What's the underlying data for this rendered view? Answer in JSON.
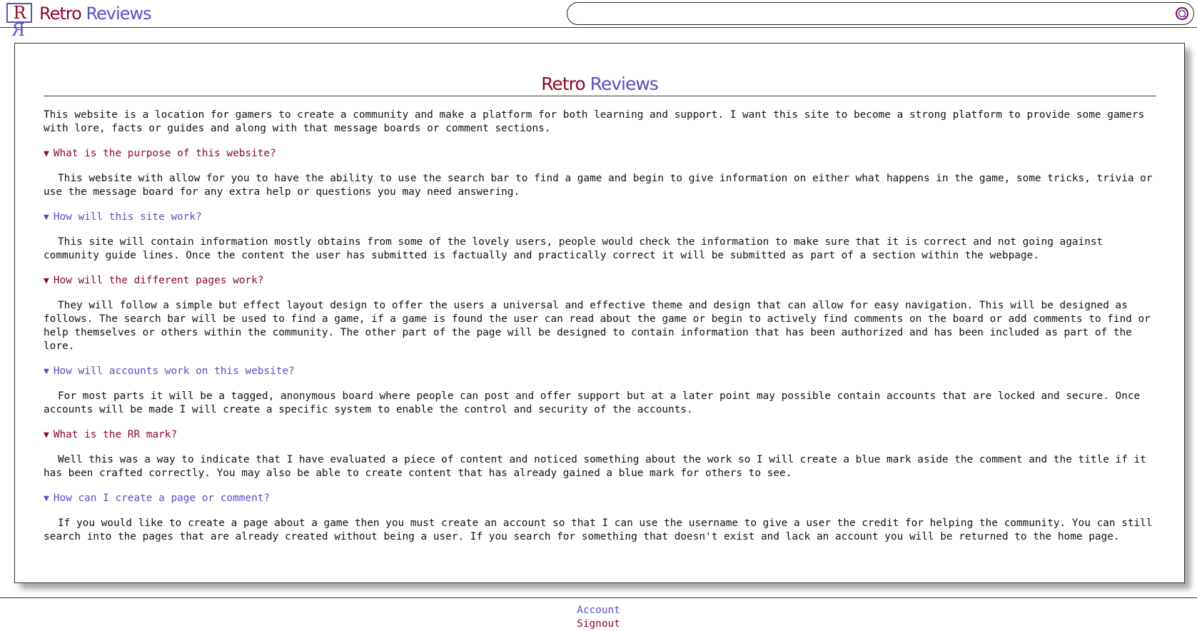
{
  "header": {
    "logo_left": "R",
    "logo_right": "R",
    "brand_word1": "Retro",
    "brand_word2": "Reviews",
    "search": {
      "value": "",
      "placeholder": ""
    }
  },
  "main": {
    "title_word1": "Retro",
    "title_word2": "Reviews",
    "intro": "This website is a location for gamers to create a community and make a platform for both learning and support. I want this site to become a strong platform to provide some gamers with lore, facts or guides and along with that message boards or comment sections.",
    "faqs": [
      {
        "question": "What is the purpose of this website?",
        "answer": "This website with allow for you to have the ability to use the search bar to find a game and begin to give information on either what happens in the game, some tricks, trivia or use the message board for any extra help or questions you may need answering."
      },
      {
        "question": "How will this site work?",
        "answer": "This site will contain information mostly obtains from some of the lovely users, people would check the information to make sure that it is correct and not going against community guide lines. Once the content the user has submitted is factually and practically correct it will be submitted as part of a section within the webpage."
      },
      {
        "question": "How will the different pages work?",
        "answer": "They will follow a simple but effect layout design to offer the users a universal and effective theme and design that can allow for easy navigation. This will be designed as follows. The search bar will be used to find a game, if a game is found the user can read about the game or begin to actively find comments on the board or add comments to find or help themselves or others within the community. The other part of the page will be designed to contain information that has been authorized and has been included as part of the lore."
      },
      {
        "question": "How will accounts work on this website?",
        "answer": "For most parts it will be a tagged, anonymous board where people can post and offer support but at a later point may possible contain accounts that are locked and secure. Once accounts will be made I will create a specific system to enable the control and security of the accounts."
      },
      {
        "question": "What is the RR mark?",
        "answer": "Well this was a way to indicate that I have evaluated a piece of content and noticed something about the work so I will create a blue mark aside the comment and the title if it has been crafted correctly. You may also be able to create content that has already gained a blue mark for others to see."
      },
      {
        "question": "How can I create a page or comment?",
        "answer": "If you would like to create a page about a game then you must create an account so that I can use the username to give a user the credit for helping the community. You can still search into the pages that are already created without being a user. If you search for something that doesn't exist and lack an account you will be returned to the home page."
      }
    ],
    "disclosure_icon": "triangle-down-icon"
  },
  "footer": {
    "account_link": "Account",
    "signout_link": "Signout"
  },
  "colors": {
    "brand_red": "#8b0a2a",
    "brand_blue": "#5a4fc2"
  }
}
